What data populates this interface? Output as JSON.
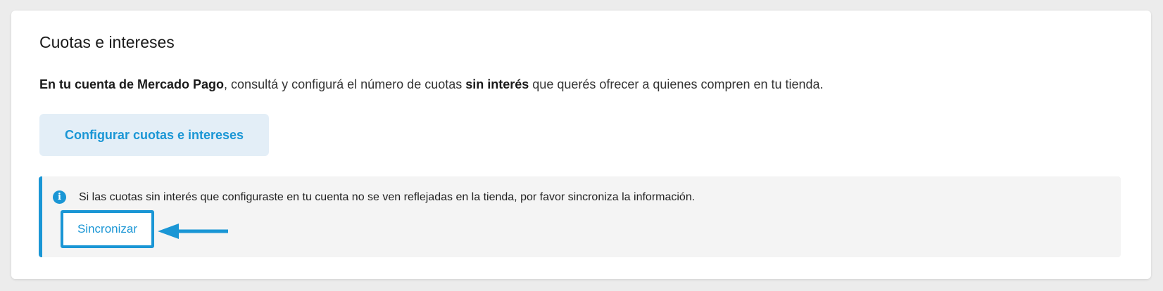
{
  "section": {
    "title": "Cuotas e intereses",
    "description": {
      "part1_bold": "En tu cuenta de Mercado Pago",
      "part2": ", consultá y configurá el número de cuotas ",
      "part3_bold": "sin interés",
      "part4": " que querés ofrecer a quienes compren en tu tienda."
    },
    "config_button_label": "Configurar cuotas e intereses"
  },
  "info_box": {
    "icon": "info-icon",
    "message": "Si las cuotas sin interés que configuraste en tu cuenta no se ven reflejadas en la tienda, por favor sincroniza la información.",
    "sync_button_label": "Sincronizar"
  },
  "colors": {
    "accent": "#1a96d5",
    "button_bg": "#e3eef7",
    "info_bg": "#f4f4f4",
    "page_bg": "#ececec"
  }
}
